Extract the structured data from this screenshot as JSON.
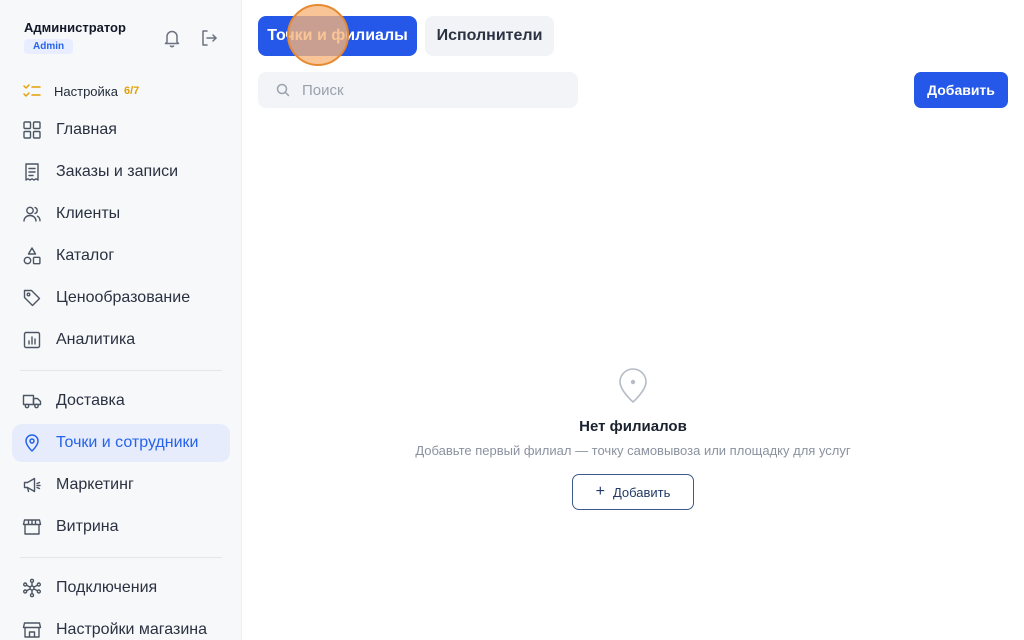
{
  "user": {
    "name": "Администратор",
    "role": "Admin"
  },
  "setup": {
    "label": "Настройка",
    "progress": "6/7"
  },
  "sidebar": {
    "items": [
      {
        "label": "Главная",
        "icon": "grid-icon"
      },
      {
        "label": "Заказы и записи",
        "icon": "receipt-icon"
      },
      {
        "label": "Клиенты",
        "icon": "users-icon"
      },
      {
        "label": "Каталог",
        "icon": "shapes-icon"
      },
      {
        "label": "Ценообразование",
        "icon": "tag-icon"
      },
      {
        "label": "Аналитика",
        "icon": "chart-icon"
      },
      {
        "label": "Доставка",
        "icon": "truck-icon"
      },
      {
        "label": "Точки и сотрудники",
        "icon": "map-pin-icon",
        "active": true
      },
      {
        "label": "Маркетинг",
        "icon": "megaphone-icon"
      },
      {
        "label": "Витрина",
        "icon": "storefront-icon"
      },
      {
        "label": "Подключения",
        "icon": "network-icon"
      },
      {
        "label": "Настройки магазина",
        "icon": "store-settings-icon"
      }
    ]
  },
  "tabs": [
    {
      "label": "Точки и филиалы",
      "active": true
    },
    {
      "label": "Исполнители",
      "active": false
    }
  ],
  "search": {
    "placeholder": "Поиск",
    "value": ""
  },
  "toolbar": {
    "add_label": "Добавить"
  },
  "empty_state": {
    "title": "Нет филиалов",
    "subtitle": "Добавьте первый филиал — точку самовывоза или площадку для услуг",
    "button_label": "Добавить"
  },
  "colors": {
    "accent": "#2558e8",
    "active_nav_bg": "#e6ecfb",
    "warning": "#e3a008",
    "sidebar_bg": "#f7f8fa"
  }
}
